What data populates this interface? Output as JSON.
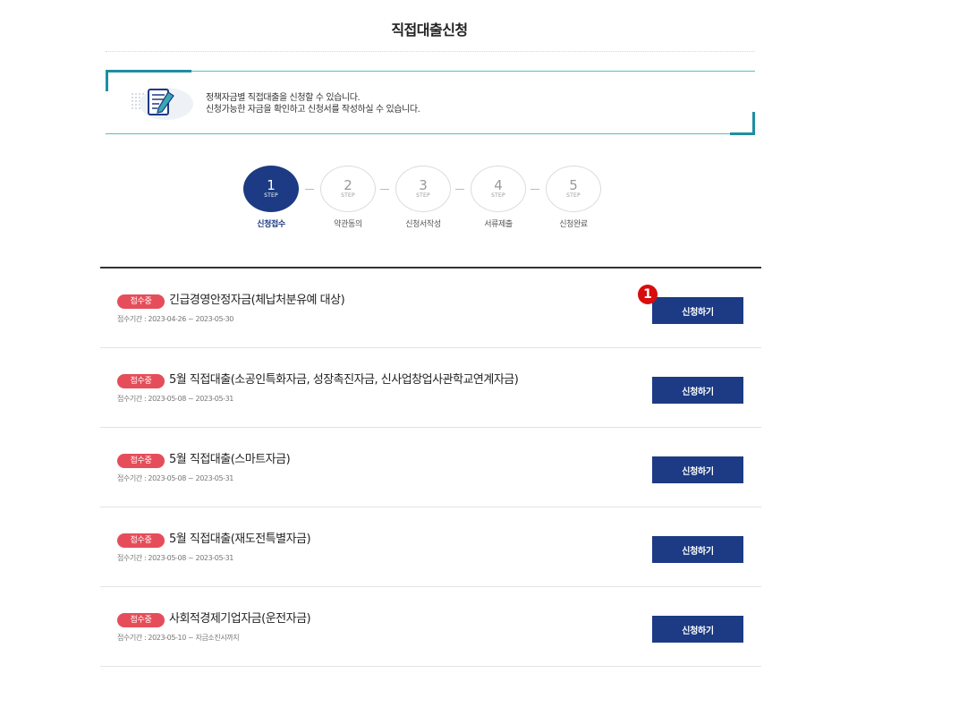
{
  "page": {
    "title": "직접대출신청"
  },
  "info": {
    "line1": "정책자금별 직접대출을 신청할 수 있습니다.",
    "line2": "신청가능한 자금을 확인하고 신청서를 작성하실 수 있습니다."
  },
  "steps": [
    {
      "num": "1",
      "step": "STEP",
      "label": "신청접수",
      "active": true
    },
    {
      "num": "2",
      "step": "STEP",
      "label": "약관동의",
      "active": false
    },
    {
      "num": "3",
      "step": "STEP",
      "label": "신청서작성",
      "active": false
    },
    {
      "num": "4",
      "step": "STEP",
      "label": "서류제출",
      "active": false
    },
    {
      "num": "5",
      "step": "STEP",
      "label": "신청완료",
      "active": false
    }
  ],
  "list": [
    {
      "badge": "접수중",
      "name": "긴급경영안정자금(체납처분유예 대상)",
      "period": "접수기간 : 2023-04-26 ~ 2023-05-30",
      "button": "신청하기"
    },
    {
      "badge": "접수중",
      "name": "5월 직접대출(소공인특화자금, 성장촉진자금, 신사업창업사관학교연계자금)",
      "period": "접수기간 : 2023-05-08 ~ 2023-05-31",
      "button": "신청하기"
    },
    {
      "badge": "접수중",
      "name": "5월 직접대출(스마트자금)",
      "period": "접수기간 : 2023-05-08 ~ 2023-05-31",
      "button": "신청하기"
    },
    {
      "badge": "접수중",
      "name": "5월 직접대출(재도전특별자금)",
      "period": "접수기간 : 2023-05-08 ~ 2023-05-31",
      "button": "신청하기"
    },
    {
      "badge": "접수중",
      "name": "사회적경제기업자금(운전자금)",
      "period": "접수기간 : 2023-05-10 ~ 자금소진시까지",
      "button": "신청하기"
    }
  ],
  "marker": {
    "label": "1"
  },
  "colors": {
    "primary": "#1c3b84",
    "badge": "#e64d5a",
    "accent": "#1f8ea0",
    "marker": "#d80d0d"
  },
  "icons": {
    "info": "document-pen-icon"
  }
}
